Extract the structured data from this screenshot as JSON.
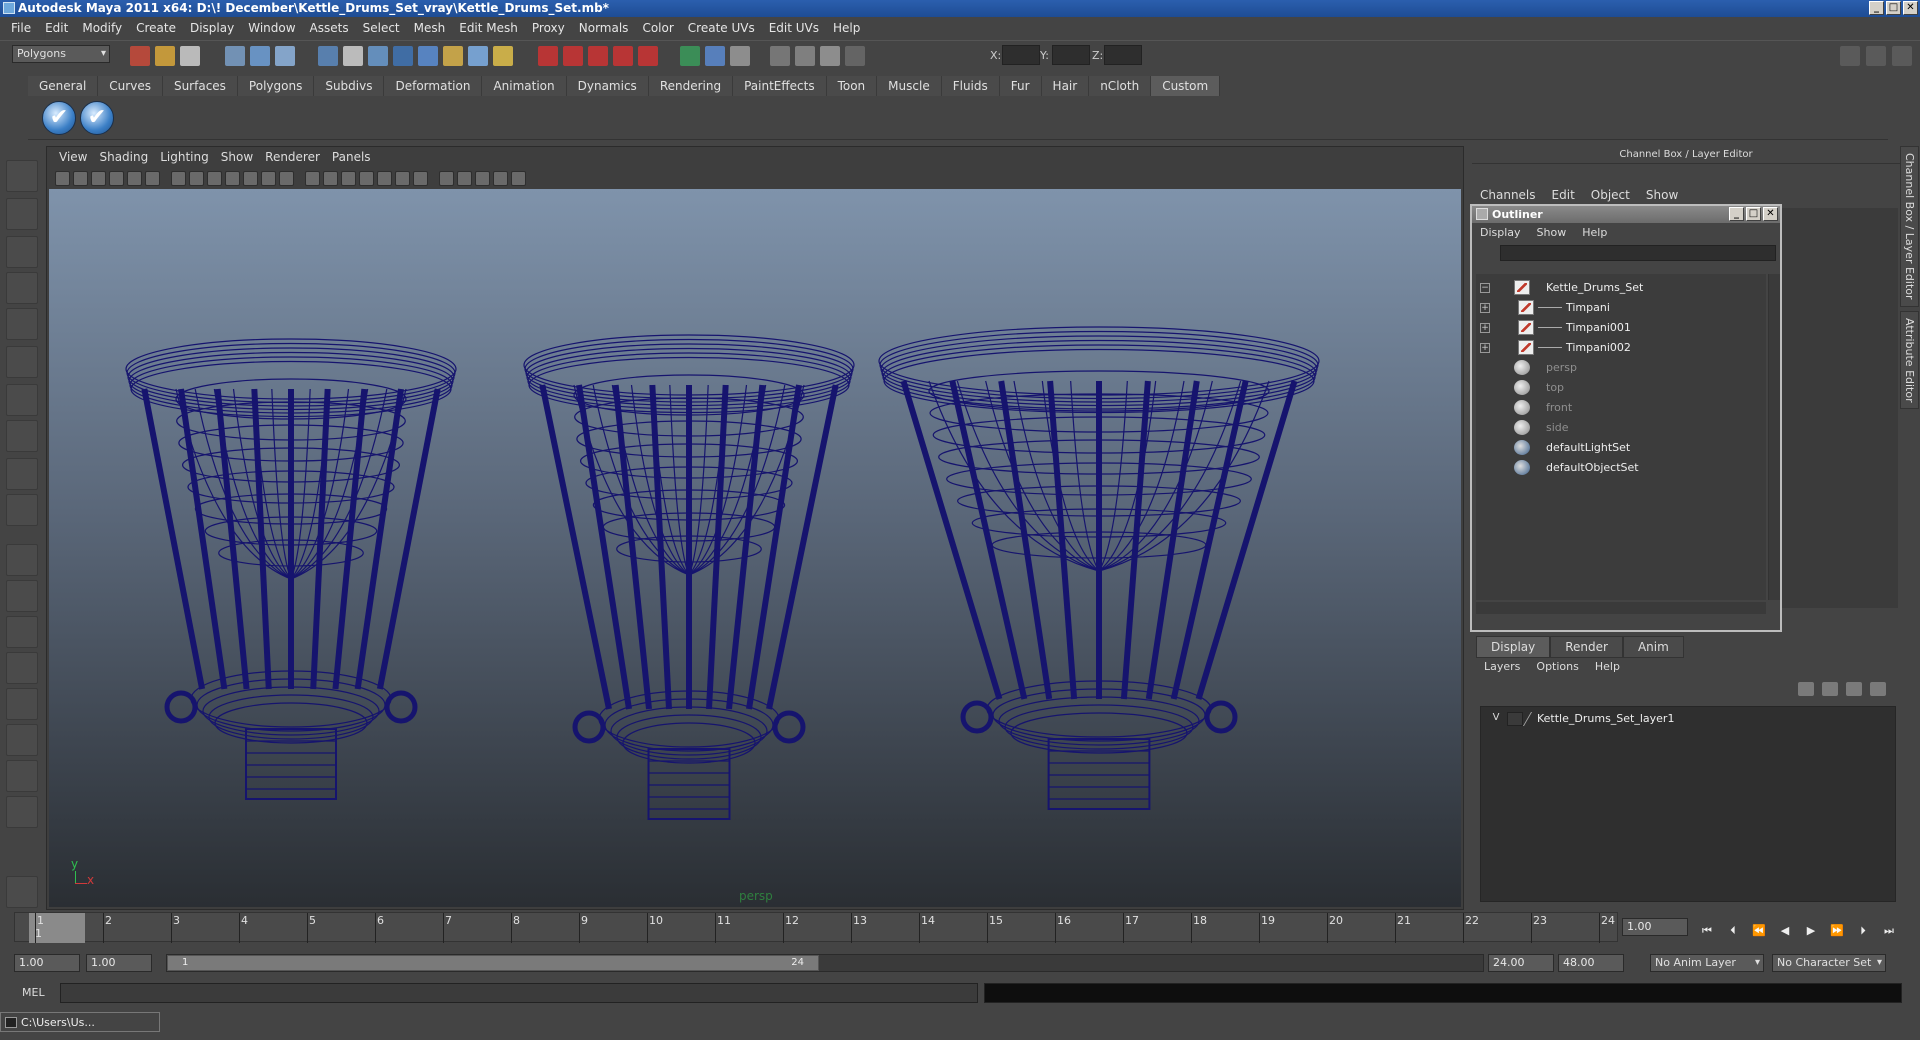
{
  "window": {
    "title": "Autodesk Maya 2011 x64: D:\\! December\\Kettle_Drums_Set_vray\\Kettle_Drums_Set.mb*",
    "min": "_",
    "max": "□",
    "close": "✕"
  },
  "menubar": [
    "File",
    "Edit",
    "Modify",
    "Create",
    "Display",
    "Window",
    "Assets",
    "Select",
    "Mesh",
    "Edit Mesh",
    "Proxy",
    "Normals",
    "Color",
    "Create UVs",
    "Edit UVs",
    "Help"
  ],
  "status": {
    "mode": "Polygons",
    "x_label": "X:",
    "y_label": "Y:",
    "z_label": "Z:"
  },
  "shelf": {
    "tabs": [
      "General",
      "Curves",
      "Surfaces",
      "Polygons",
      "Subdivs",
      "Deformation",
      "Animation",
      "Dynamics",
      "Rendering",
      "PaintEffects",
      "Toon",
      "Muscle",
      "Fluids",
      "Fur",
      "Hair",
      "nCloth",
      "Custom"
    ],
    "active_tab": "Custom",
    "button_glyph": "✔"
  },
  "viewport": {
    "menu": [
      "View",
      "Shading",
      "Lighting",
      "Show",
      "Renderer",
      "Panels"
    ],
    "camera_label": "persp",
    "axis_y": "y",
    "axis_x": "x",
    "wire_color": "#16146e"
  },
  "channelbox": {
    "title": "Channel Box / Layer Editor",
    "menu": [
      "Channels",
      "Edit",
      "Object",
      "Show"
    ]
  },
  "outliner": {
    "title": "Outliner",
    "menu": [
      "Display",
      "Show",
      "Help"
    ],
    "items": [
      {
        "label": "Kettle_Drums_Set",
        "icon": "mesh-icon",
        "expander": "−",
        "indent": 0,
        "dim": false
      },
      {
        "label": "Timpani",
        "icon": "mesh-icon",
        "expander": "+",
        "indent": 1,
        "dim": false
      },
      {
        "label": "Timpani001",
        "icon": "mesh-icon",
        "expander": "+",
        "indent": 1,
        "dim": false
      },
      {
        "label": "Timpani002",
        "icon": "mesh-icon",
        "expander": "+",
        "indent": 1,
        "dim": false
      },
      {
        "label": "persp",
        "icon": "camera-icon",
        "expander": "",
        "indent": 0,
        "dim": true
      },
      {
        "label": "top",
        "icon": "camera-icon",
        "expander": "",
        "indent": 0,
        "dim": true
      },
      {
        "label": "front",
        "icon": "camera-icon",
        "expander": "",
        "indent": 0,
        "dim": true
      },
      {
        "label": "side",
        "icon": "camera-icon",
        "expander": "",
        "indent": 0,
        "dim": true
      },
      {
        "label": "defaultLightSet",
        "icon": "set-icon",
        "expander": "",
        "indent": 0,
        "dim": false
      },
      {
        "label": "defaultObjectSet",
        "icon": "set-icon",
        "expander": "",
        "indent": 0,
        "dim": false
      }
    ]
  },
  "layer_editor": {
    "tabs": [
      "Display",
      "Render",
      "Anim"
    ],
    "active_tab": "Display",
    "menu": [
      "Layers",
      "Options",
      "Help"
    ],
    "layer": {
      "visible": "V",
      "name": "Kettle_Drums_Set_layer1"
    }
  },
  "timeline": {
    "ticks": [
      "1",
      "2",
      "3",
      "4",
      "5",
      "6",
      "7",
      "8",
      "9",
      "10",
      "11",
      "12",
      "13",
      "14",
      "15",
      "16",
      "17",
      "18",
      "19",
      "20",
      "21",
      "22",
      "23",
      "24"
    ],
    "current_frame_label": "1",
    "current_time": "1.00"
  },
  "range": {
    "start": "1.00",
    "playback_start": "1.00",
    "slider_start": "1",
    "slider_end": "24",
    "playback_end": "24.00",
    "end": "48.00",
    "anim_layer": "No Anim Layer",
    "character_set": "No Character Set"
  },
  "cmdline": {
    "label": "MEL"
  },
  "taskbar": {
    "label": "C:\\Users\\Us..."
  },
  "side_tabs": [
    "Channel Box / Layer Editor",
    "Attribute Editor"
  ]
}
